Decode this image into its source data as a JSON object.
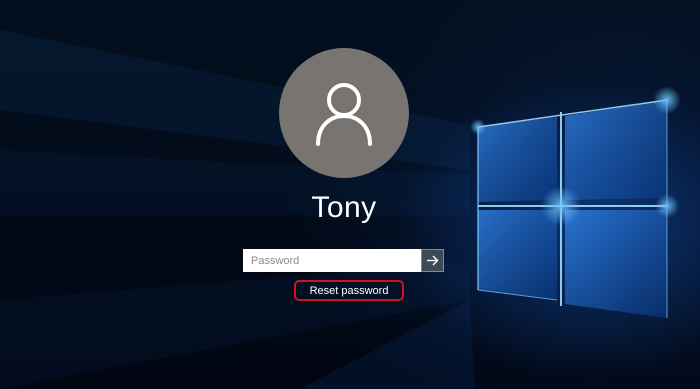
{
  "user": {
    "name": "Tony",
    "avatar_icon": "user-silhouette-icon"
  },
  "password_field": {
    "placeholder": "Password",
    "value": ""
  },
  "submit": {
    "icon": "arrow-right-icon"
  },
  "reset": {
    "label": "Reset password",
    "highlight_color": "#d4111e"
  },
  "wallpaper": {
    "logo": "windows-logo",
    "accent": "#2a8cff"
  }
}
